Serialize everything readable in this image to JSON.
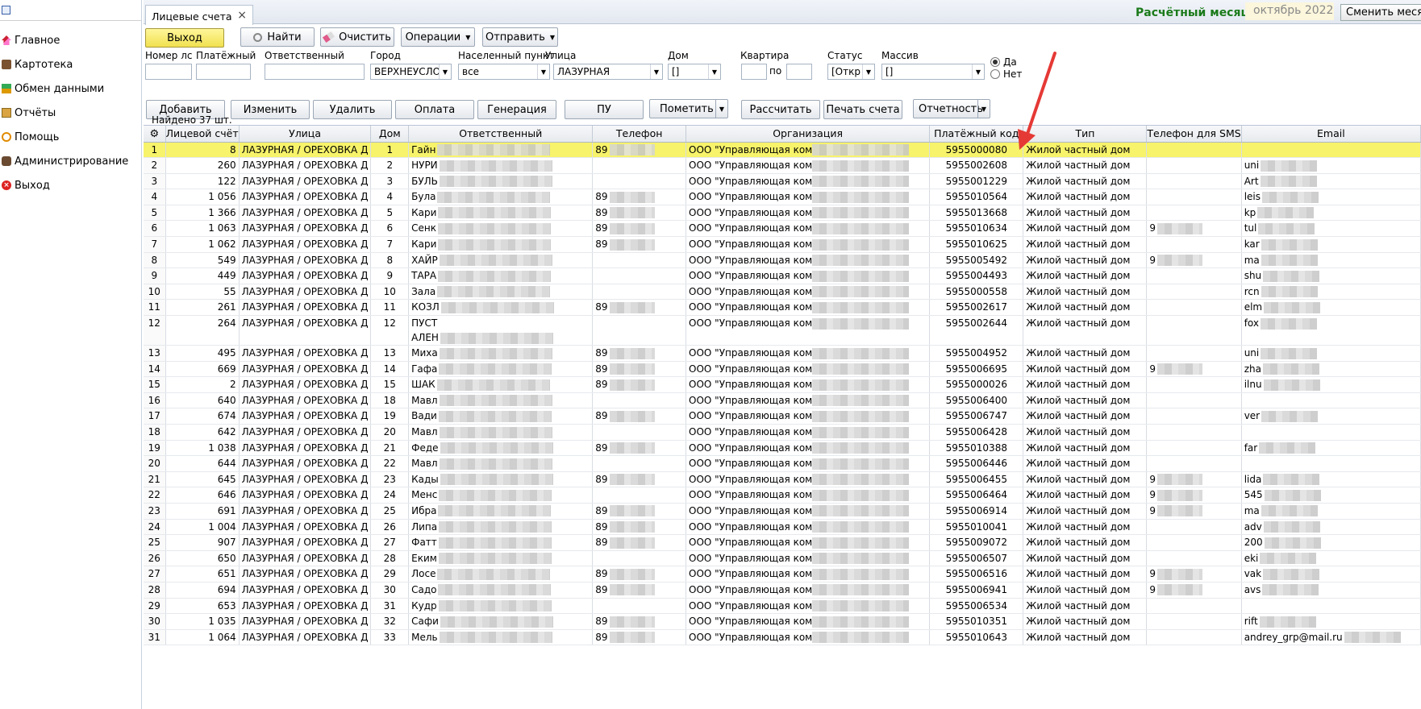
{
  "sidebar": {
    "items": [
      {
        "label": "Главное",
        "icon": "home-icon"
      },
      {
        "label": "Картотека",
        "icon": "card-file-icon"
      },
      {
        "label": "Обмен данными",
        "icon": "data-exchange-icon"
      },
      {
        "label": "Отчёты",
        "icon": "reports-icon"
      },
      {
        "label": "Помощь",
        "icon": "help-icon"
      },
      {
        "label": "Администрирование",
        "icon": "admin-icon"
      },
      {
        "label": "Выход",
        "icon": "exit-icon"
      }
    ]
  },
  "tab": {
    "label": "Лицевые счета",
    "close": "×"
  },
  "header": {
    "calc_month_label": "Расчётный месяц",
    "calc_month_value": "октябрь 2022",
    "change_month_button": "Сменить месяц"
  },
  "toolbar1": {
    "exit": "Выход",
    "find": "Найти",
    "clear": "Очистить",
    "operations": "Операции",
    "send": "Отправить"
  },
  "filters": {
    "account_label": "Номер лс",
    "account_value": "",
    "payment_label": "Платёжный",
    "payment_value": "",
    "responsible_label": "Ответственный",
    "responsible_value": "",
    "city_label": "Город",
    "city_value": "ВЕРХНЕУСЛОНС",
    "settlement_label": "Населенный пункт",
    "settlement_value": "все",
    "street_label": "Улица",
    "street_value": "ЛАЗУРНАЯ",
    "house_label": "Дом",
    "house_value": "[]",
    "apartment_label": "Квартира",
    "apartment_from": "",
    "apartment_to_label": "по",
    "apartment_to": "",
    "status_label": "Статус",
    "status_value": "[Откр",
    "massiv_label": "Массив",
    "massiv_value": "[]",
    "radio_yes": "Да",
    "radio_no": "Нет"
  },
  "toolbar2": {
    "add": "Добавить",
    "edit": "Изменить",
    "delete": "Удалить",
    "payment": "Оплата",
    "generation": "Генерация",
    "pu": "ПУ",
    "mark": "Пометить",
    "calculate": "Рассчитать",
    "print": "Печать счета",
    "reporting": "Отчетность"
  },
  "found_text": "Найдено 37 шт.",
  "columns": [
    "Лицевой счёт",
    "Улица",
    "Дом",
    "Ответственный",
    "Телефон",
    "Организация",
    "Платёжный код",
    "Тип",
    "Телефон для SMS",
    "Email"
  ],
  "rows": [
    {
      "n": "1",
      "acc": "8",
      "street": "ЛАЗУРНАЯ / ОРЕХОВКА Д",
      "house": "1",
      "resp": "Гайн",
      "phone": "89",
      "org": "ООО \"Управляющая ком",
      "code": "5955000080",
      "type": "Жилой частный дом",
      "sms": "",
      "email": ""
    },
    {
      "n": "2",
      "acc": "260",
      "street": "ЛАЗУРНАЯ / ОРЕХОВКА Д",
      "house": "2",
      "resp": "НУРИ",
      "phone": "",
      "org": "ООО \"Управляющая ком",
      "code": "5955002608",
      "type": "Жилой частный дом",
      "sms": "",
      "email": "uni"
    },
    {
      "n": "3",
      "acc": "122",
      "street": "ЛАЗУРНАЯ / ОРЕХОВКА Д",
      "house": "3",
      "resp": "БУЛЬ",
      "phone": "",
      "org": "ООО \"Управляющая ком",
      "code": "5955001229",
      "type": "Жилой частный дом",
      "sms": "",
      "email": "Art"
    },
    {
      "n": "4",
      "acc": "1 056",
      "street": "ЛАЗУРНАЯ / ОРЕХОВКА Д",
      "house": "4",
      "resp": "Була",
      "phone": "89",
      "org": "ООО \"Управляющая ком",
      "code": "5955010564",
      "type": "Жилой частный дом",
      "sms": "",
      "email": "leis"
    },
    {
      "n": "5",
      "acc": "1 366",
      "street": "ЛАЗУРНАЯ / ОРЕХОВКА Д",
      "house": "5",
      "resp": "Кари",
      "phone": "89",
      "org": "ООО \"Управляющая ком",
      "code": "5955013668",
      "type": "Жилой частный дом",
      "sms": "",
      "email": "kp"
    },
    {
      "n": "6",
      "acc": "1 063",
      "street": "ЛАЗУРНАЯ / ОРЕХОВКА Д",
      "house": "6",
      "resp": "Сенк",
      "phone": "89",
      "org": "ООО \"Управляющая ком",
      "code": "5955010634",
      "type": "Жилой частный дом",
      "sms": "9",
      "email": "tul"
    },
    {
      "n": "7",
      "acc": "1 062",
      "street": "ЛАЗУРНАЯ / ОРЕХОВКА Д",
      "house": "7",
      "resp": "Кари",
      "phone": "89",
      "org": "ООО \"Управляющая ком",
      "code": "5955010625",
      "type": "Жилой частный дом",
      "sms": "",
      "email": "kar"
    },
    {
      "n": "8",
      "acc": "549",
      "street": "ЛАЗУРНАЯ / ОРЕХОВКА Д",
      "house": "8",
      "resp": "ХАЙР",
      "phone": "",
      "org": "ООО \"Управляющая ком",
      "code": "5955005492",
      "type": "Жилой частный дом",
      "sms": "9",
      "email": "ma"
    },
    {
      "n": "9",
      "acc": "449",
      "street": "ЛАЗУРНАЯ / ОРЕХОВКА Д",
      "house": "9",
      "resp": "ТАРА",
      "phone": "",
      "org": "ООО \"Управляющая ком",
      "code": "5955004493",
      "type": "Жилой частный дом",
      "sms": "",
      "email": "shu"
    },
    {
      "n": "10",
      "acc": "55",
      "street": "ЛАЗУРНАЯ / ОРЕХОВКА Д",
      "house": "10",
      "resp": "Зала",
      "phone": "",
      "org": "ООО \"Управляющая ком",
      "code": "5955000558",
      "type": "Жилой частный дом",
      "sms": "",
      "email": "rcn"
    },
    {
      "n": "11",
      "acc": "261",
      "street": "ЛАЗУРНАЯ / ОРЕХОВКА Д",
      "house": "11",
      "resp": "КОЗЛ",
      "phone": "89",
      "org": "ООО \"Управляющая ком",
      "code": "5955002617",
      "type": "Жилой частный дом",
      "sms": "",
      "email": "elm"
    },
    {
      "n": "12",
      "acc": "264",
      "street": "ЛАЗУРНАЯ / ОРЕХОВКА Д",
      "house": "12",
      "resp": "ПУСТ",
      "resp2": "АЛЕН",
      "phone": "",
      "org": "ООО \"Управляющая ком",
      "code": "5955002644",
      "type": "Жилой частный дом",
      "sms": "",
      "email": "fox",
      "tall": true
    },
    {
      "n": "13",
      "acc": "495",
      "street": "ЛАЗУРНАЯ / ОРЕХОВКА Д",
      "house": "13",
      "resp": "Миха",
      "phone": "89",
      "org": "ООО \"Управляющая ком",
      "code": "5955004952",
      "type": "Жилой частный дом",
      "sms": "",
      "email": "uni"
    },
    {
      "n": "14",
      "acc": "669",
      "street": "ЛАЗУРНАЯ / ОРЕХОВКА Д",
      "house": "14",
      "resp": "Гафа",
      "phone": "89",
      "org": "ООО \"Управляющая ком",
      "code": "5955006695",
      "type": "Жилой частный дом",
      "sms": "9",
      "email": "zha"
    },
    {
      "n": "15",
      "acc": "2",
      "street": "ЛАЗУРНАЯ / ОРЕХОВКА Д",
      "house": "15",
      "resp": "ШАК",
      "phone": "89",
      "org": "ООО \"Управляющая ком",
      "code": "5955000026",
      "type": "Жилой частный дом",
      "sms": "",
      "email": "ilnu"
    },
    {
      "n": "16",
      "acc": "640",
      "street": "ЛАЗУРНАЯ / ОРЕХОВКА Д",
      "house": "18",
      "resp": "Мавл",
      "phone": "",
      "org": "ООО \"Управляющая ком",
      "code": "5955006400",
      "type": "Жилой частный дом",
      "sms": "",
      "email": ""
    },
    {
      "n": "17",
      "acc": "674",
      "street": "ЛАЗУРНАЯ / ОРЕХОВКА Д",
      "house": "19",
      "resp": "Вади",
      "phone": "89",
      "org": "ООО \"Управляющая ком",
      "code": "5955006747",
      "type": "Жилой частный дом",
      "sms": "",
      "email": "ver"
    },
    {
      "n": "18",
      "acc": "642",
      "street": "ЛАЗУРНАЯ / ОРЕХОВКА Д",
      "house": "20",
      "resp": "Мавл",
      "phone": "",
      "org": "ООО \"Управляющая ком",
      "code": "5955006428",
      "type": "Жилой частный дом",
      "sms": "",
      "email": ""
    },
    {
      "n": "19",
      "acc": "1 038",
      "street": "ЛАЗУРНАЯ / ОРЕХОВКА Д",
      "house": "21",
      "resp": "Феде",
      "phone": "89",
      "org": "ООО \"Управляющая ком",
      "code": "5955010388",
      "type": "Жилой частный дом",
      "sms": "",
      "email": "far"
    },
    {
      "n": "20",
      "acc": "644",
      "street": "ЛАЗУРНАЯ / ОРЕХОВКА Д",
      "house": "22",
      "resp": "Мавл",
      "phone": "",
      "org": "ООО \"Управляющая ком",
      "code": "5955006446",
      "type": "Жилой частный дом",
      "sms": "",
      "email": ""
    },
    {
      "n": "21",
      "acc": "645",
      "street": "ЛАЗУРНАЯ / ОРЕХОВКА Д",
      "house": "23",
      "resp": "Кады",
      "phone": "89",
      "org": "ООО \"Управляющая ком",
      "code": "5955006455",
      "type": "Жилой частный дом",
      "sms": "9",
      "email": "lida"
    },
    {
      "n": "22",
      "acc": "646",
      "street": "ЛАЗУРНАЯ / ОРЕХОВКА Д",
      "house": "24",
      "resp": "Менс",
      "phone": "",
      "org": "ООО \"Управляющая ком",
      "code": "5955006464",
      "type": "Жилой частный дом",
      "sms": "9",
      "email": "545"
    },
    {
      "n": "23",
      "acc": "691",
      "street": "ЛАЗУРНАЯ / ОРЕХОВКА Д",
      "house": "25",
      "resp": "Ибра",
      "phone": "89",
      "org": "ООО \"Управляющая ком",
      "code": "5955006914",
      "type": "Жилой частный дом",
      "sms": "9",
      "email": "ma"
    },
    {
      "n": "24",
      "acc": "1 004",
      "street": "ЛАЗУРНАЯ / ОРЕХОВКА Д",
      "house": "26",
      "resp": "Липа",
      "phone": "89",
      "org": "ООО \"Управляющая ком",
      "code": "5955010041",
      "type": "Жилой частный дом",
      "sms": "",
      "email": "adv"
    },
    {
      "n": "25",
      "acc": "907",
      "street": "ЛАЗУРНАЯ / ОРЕХОВКА Д",
      "house": "27",
      "resp": "Фатт",
      "phone": "89",
      "org": "ООО \"Управляющая ком",
      "code": "5955009072",
      "type": "Жилой частный дом",
      "sms": "",
      "email": "200"
    },
    {
      "n": "26",
      "acc": "650",
      "street": "ЛАЗУРНАЯ / ОРЕХОВКА Д",
      "house": "28",
      "resp": "Еким",
      "phone": "",
      "org": "ООО \"Управляющая ком",
      "code": "5955006507",
      "type": "Жилой частный дом",
      "sms": "",
      "email": "eki"
    },
    {
      "n": "27",
      "acc": "651",
      "street": "ЛАЗУРНАЯ / ОРЕХОВКА Д",
      "house": "29",
      "resp": "Лосе",
      "phone": "89",
      "org": "ООО \"Управляющая ком",
      "code": "5955006516",
      "type": "Жилой частный дом",
      "sms": "9",
      "email": "vak"
    },
    {
      "n": "28",
      "acc": "694",
      "street": "ЛАЗУРНАЯ / ОРЕХОВКА Д",
      "house": "30",
      "resp": "Садо",
      "phone": "89",
      "org": "ООО \"Управляющая ком",
      "code": "5955006941",
      "type": "Жилой частный дом",
      "sms": "9",
      "email": "avs"
    },
    {
      "n": "29",
      "acc": "653",
      "street": "ЛАЗУРНАЯ / ОРЕХОВКА Д",
      "house": "31",
      "resp": "Кудр",
      "phone": "",
      "org": "ООО \"Управляющая ком",
      "code": "5955006534",
      "type": "Жилой частный дом",
      "sms": "",
      "email": ""
    },
    {
      "n": "30",
      "acc": "1 035",
      "street": "ЛАЗУРНАЯ / ОРЕХОВКА Д",
      "house": "32",
      "resp": "Сафи",
      "phone": "89",
      "org": "ООО \"Управляющая ком",
      "code": "5955010351",
      "type": "Жилой частный дом",
      "sms": "",
      "email": "rift"
    },
    {
      "n": "31",
      "acc": "1 064",
      "street": "ЛАЗУРНАЯ / ОРЕХОВКА Д",
      "house": "33",
      "resp": "Мель",
      "phone": "89",
      "org": "ООО \"Управляющая ком",
      "code": "5955010643",
      "type": "Жилой частный дом",
      "sms": "",
      "email": "andrey_grp@mail.ru"
    }
  ]
}
